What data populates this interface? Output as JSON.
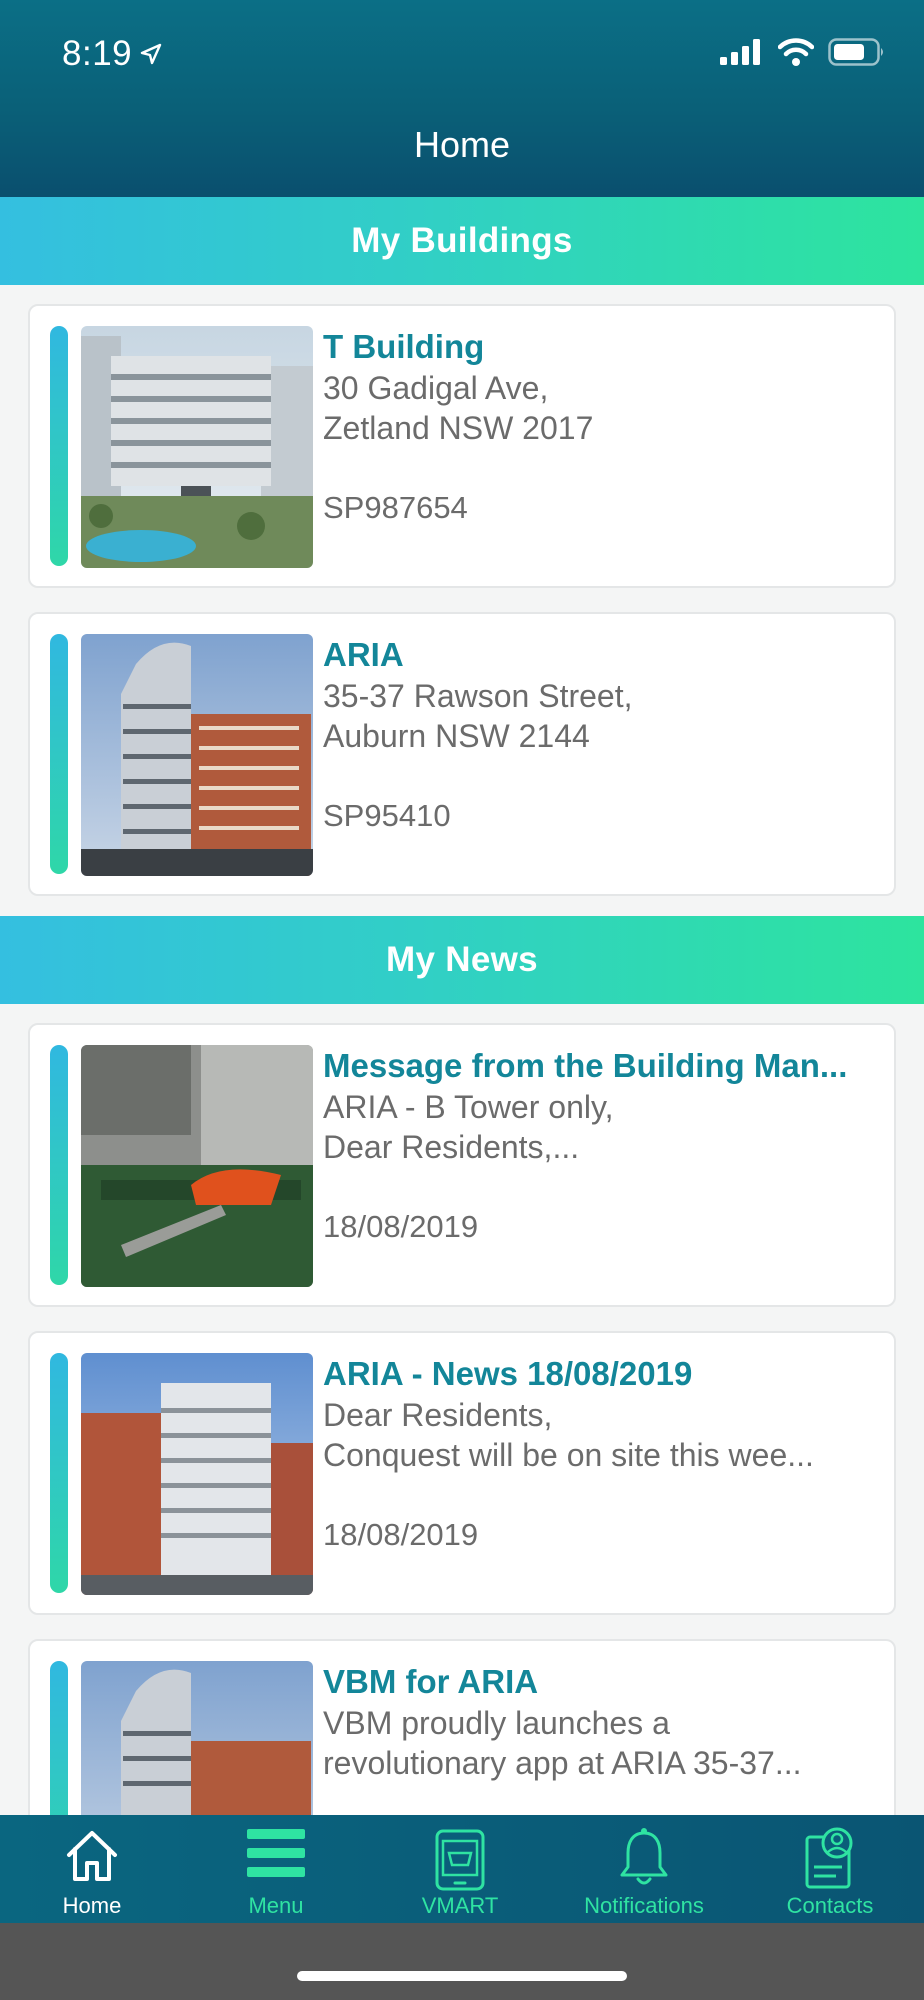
{
  "status_bar": {
    "time": "8:19"
  },
  "header": {
    "title": "Home"
  },
  "sections": {
    "buildings_title": "My Buildings",
    "news_title": "My News"
  },
  "buildings": [
    {
      "name": "T Building",
      "address_line1": "30 Gadigal Ave,",
      "address_line2": "Zetland NSW 2017",
      "plan": "SP987654"
    },
    {
      "name": "ARIA",
      "address_line1": "35-37 Rawson Street,",
      "address_line2": "Auburn NSW 2144",
      "plan": "SP95410"
    }
  ],
  "news": [
    {
      "title": "Message from the Building Man...",
      "line1": "ARIA - B Tower only,",
      "line2": "Dear Residents,...",
      "date": "18/08/2019"
    },
    {
      "title": "ARIA - News 18/08/2019",
      "line1": "Dear Residents,",
      "line2": "Conquest will be on site this wee...",
      "date": "18/08/2019"
    },
    {
      "title": "VBM for ARIA",
      "line1": "VBM proudly launches a",
      "line2": "revolutionary app at ARIA 35-37..."
    }
  ],
  "tabs": [
    {
      "label": "Home",
      "icon": "home-icon"
    },
    {
      "label": "Menu",
      "icon": "menu-icon"
    },
    {
      "label": "VMART",
      "icon": "vmart-icon"
    },
    {
      "label": "Notifications",
      "icon": "bell-icon"
    },
    {
      "label": "Contacts",
      "icon": "contacts-icon"
    }
  ],
  "colors": {
    "header": "#0a6078",
    "accent_teal": "#138699",
    "gradient_start": "#34bfe0",
    "gradient_end": "#2de49e",
    "tab_green": "#2fe3a2"
  }
}
